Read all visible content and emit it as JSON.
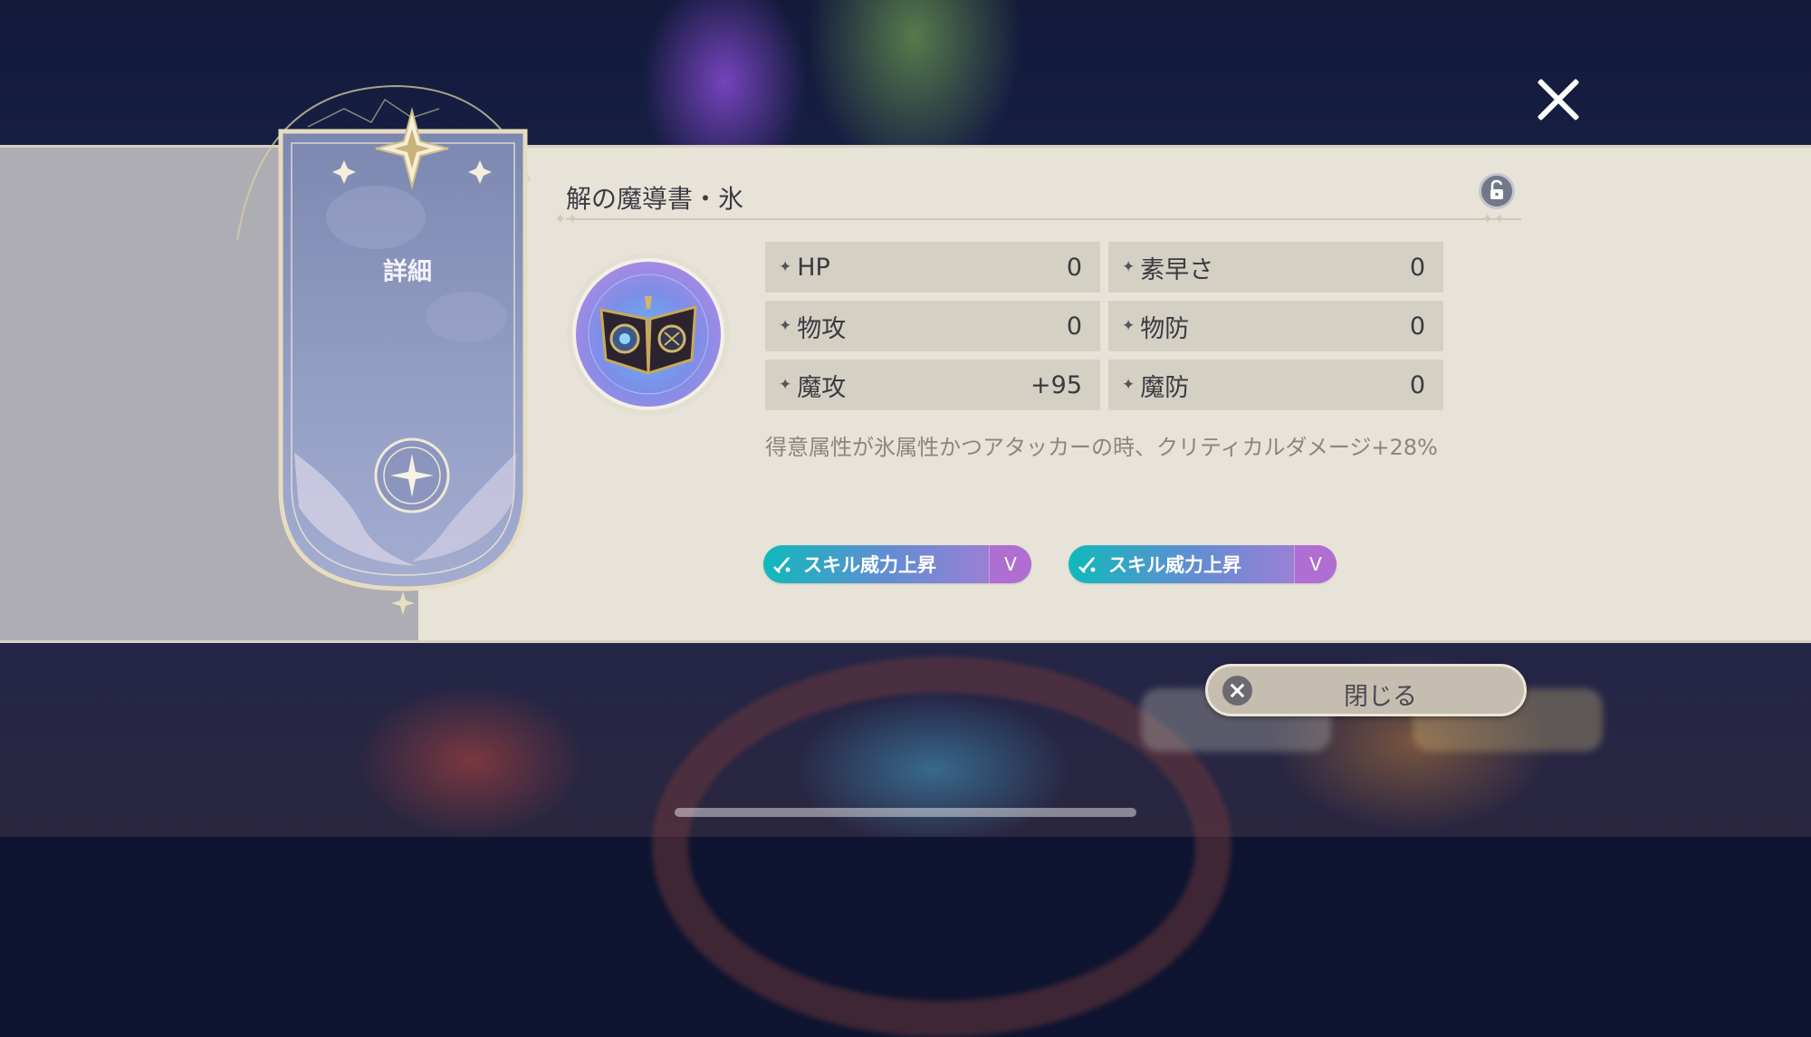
{
  "item": {
    "name": "解の魔導書・氷",
    "icon": "ice-grimoire-icon"
  },
  "banner": {
    "label": "詳細"
  },
  "stats": [
    {
      "name": "HP",
      "value": "0"
    },
    {
      "name": "素早さ",
      "value": "0"
    },
    {
      "name": "物攻",
      "value": "0"
    },
    {
      "name": "物防",
      "value": "0"
    },
    {
      "name": "魔攻",
      "value": "+95"
    },
    {
      "name": "魔防",
      "value": "0"
    }
  ],
  "description": "得意属性が氷属性かつアタッカーの時、クリティカルダメージ+28%",
  "skills": [
    {
      "label": "スキル威力上昇",
      "level": "V"
    },
    {
      "label": "スキル威力上昇",
      "level": "V"
    }
  ],
  "buttons": {
    "close_label": "閉じる"
  },
  "colors": {
    "panel_bg": "#e8e3d8",
    "banner_bg": "#8c97bd",
    "skill_gradient_start": "#10b9bb",
    "skill_gradient_end": "#b27ad6"
  }
}
